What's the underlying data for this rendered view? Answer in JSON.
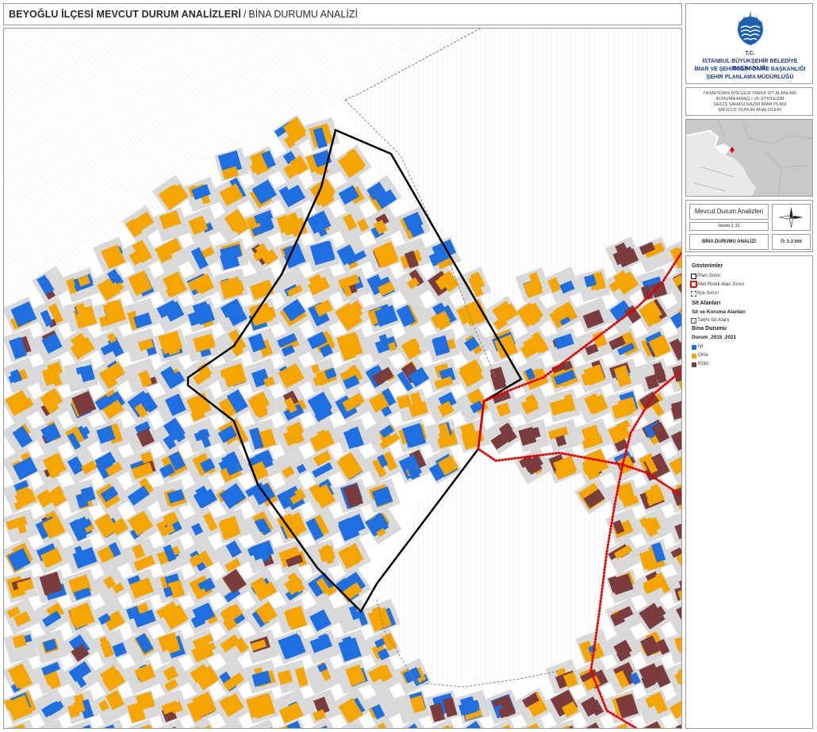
{
  "header": {
    "title": "BEYOĞLU İLÇESİ MEVCUT DURUM ANALİZLERİ",
    "separator": "/",
    "subtitle": "BİNA DURUMU ANALİZİ"
  },
  "org": {
    "line1": "T.C.",
    "line2": "İSTANBUL BÜYÜKŞEHİR BELEDİYE BAŞKANLIĞI",
    "line3": "İMAR VE ŞEHİRCİLİK DAİRE BAŞKANLIĞI",
    "line4": "ŞEHİR PLANLAMA MÜDÜRLÜĞÜ"
  },
  "description": {
    "line1": "OKMEYDANI BÖLGESİ TARİHİ SİT ALANLARI",
    "line2": "KORUMA AMAÇLI VE ETKİLEŞİM",
    "line3": "GEÇİŞ SAHASI NAZIM İMAR PLANI",
    "line4": "MEVCUT DURUM ANALİZLERİ"
  },
  "info": {
    "analysis_title": "Mevcut Durum Analizleri",
    "map_no": "Harita 1.12",
    "analysis_name": "BİNA DURUMU ANALİZİ",
    "scale": "Ö: 1:2.000",
    "north_icon": "compass-rose-icon"
  },
  "legend": {
    "heading": "Gösterimler",
    "plan_boundary": "Plan Sınırı",
    "risky_area_boundary": "Afet Riskli Alan Sınırı",
    "district_boundary": "İlçe Sınırı",
    "sit_heading": "Sit Alanları",
    "sit_sub_heading": "Sit ve Koruma Alanları",
    "historic_site": "Tarihi Sit Alanı",
    "building_heading": "Bina Durumu",
    "building_field": "Durum_2015_2021",
    "classes": [
      {
        "label": "İyi",
        "color": "#1f6fe0"
      },
      {
        "label": "Orta",
        "color": "#f5a500"
      },
      {
        "label": "Kötü",
        "color": "#7a3c3c"
      }
    ]
  },
  "colors": {
    "good": "#1f6fe0",
    "medium": "#f5a500",
    "poor": "#7a3c3c",
    "road": "#ffffff",
    "block": "#d9d9d9",
    "risk_boundary": "#e00000",
    "plan_boundary": "#000000",
    "district_boundary": "#777777"
  }
}
